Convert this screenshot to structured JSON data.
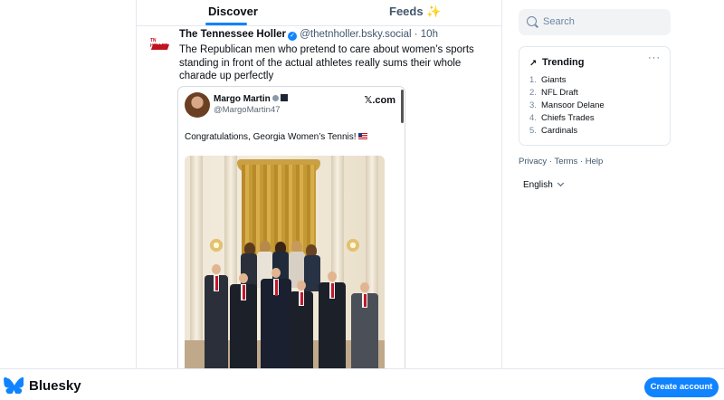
{
  "tabs": [
    {
      "label": "Discover",
      "active": true
    },
    {
      "label": "Feeds",
      "emoji": "✨"
    }
  ],
  "post": {
    "author": "The Tennessee Holler",
    "handle": "@thetnholler.bsky.social",
    "time": "· 10h",
    "avatar_text": "TN HOLLER",
    "text": "The Republican men who pretend to care about women’s sports standing in front of the actual athletes really sums their whole charade up perfectly",
    "embed": {
      "name": "Margo Martin",
      "handle": "@MargoMartin47",
      "source": "𝕏.com",
      "text": "Congratulations, Georgia Women’s Tennis!"
    }
  },
  "search": {
    "placeholder": "Search"
  },
  "trending": {
    "title": "Trending",
    "more": "···",
    "items": [
      {
        "num": "1.",
        "label": "Giants"
      },
      {
        "num": "2.",
        "label": "NFL Draft"
      },
      {
        "num": "3.",
        "label": "Mansoor Delane"
      },
      {
        "num": "4.",
        "label": "Chiefs Trades"
      },
      {
        "num": "5.",
        "label": "Cardinals"
      }
    ]
  },
  "footer": {
    "privacy": "Privacy",
    "sep": "·",
    "terms": "Terms",
    "help": "Help"
  },
  "language": "English",
  "bottom": {
    "brand": "Bluesky",
    "create_account": "Create account"
  },
  "colors": {
    "accent": "#1083fe",
    "border": "#e3e8ee",
    "muted": "#42576c"
  }
}
